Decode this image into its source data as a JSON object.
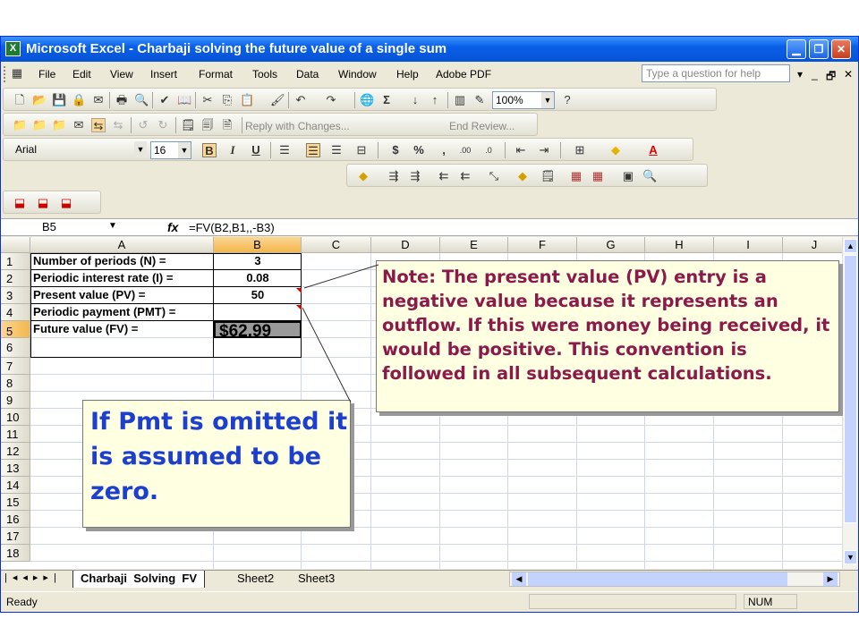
{
  "window": {
    "title": "Microsoft Excel - Charbaji solving the future value of a single sum"
  },
  "menu": {
    "items": [
      "File",
      "Edit",
      "View",
      "Insert",
      "Format",
      "Tools",
      "Data",
      "Window",
      "Help",
      "Adobe PDF"
    ],
    "question_placeholder": "Type a question for help"
  },
  "toolbar": {
    "zoom": "100%",
    "font": "Arial",
    "font_size": "16",
    "bold": "B",
    "italic": "I",
    "underline": "U",
    "reply_label": "Reply with Changes...",
    "end_review_label": "End Review..."
  },
  "formula_bar": {
    "name_box": "B5",
    "fx": "fx",
    "formula": "=FV(B2,B1,,-B3)"
  },
  "columns": [
    "A",
    "B",
    "C",
    "D",
    "E",
    "F",
    "G",
    "H",
    "I",
    "J"
  ],
  "rows": [
    "1",
    "2",
    "3",
    "4",
    "5",
    "6",
    "7",
    "8",
    "9",
    "10",
    "11",
    "12",
    "13",
    "14",
    "15",
    "16",
    "17",
    "18"
  ],
  "cells": {
    "a1": "Number of periods (N) =",
    "b1": "3",
    "a2": "Periodic interest rate (I) =",
    "b2": "0.08",
    "a3": "Present value (PV) =",
    "b3": "50",
    "a4": "Periodic payment (PMT) =",
    "a5": "Future value (FV) =",
    "b5": "$62.99"
  },
  "callouts": {
    "note": "Note: The present value (PV) entry is a negative value because it represents an outflow. If this were money being received, it would be positive. This convention is followed in all subsequent calculations.",
    "pmt": "If Pmt is omitted it is assumed to be zero."
  },
  "sheet_tabs": {
    "active": "Charbaji  Solving  FV",
    "tab2": "Sheet2",
    "tab3": "Sheet3"
  },
  "status": {
    "left": "Ready",
    "num": "NUM"
  },
  "colors": {
    "note_text": "#8b1a4a",
    "pmt_text": "#1d3fd0",
    "selected_cell": "#9a9a9a",
    "titlebar": "#0a5fe8"
  }
}
